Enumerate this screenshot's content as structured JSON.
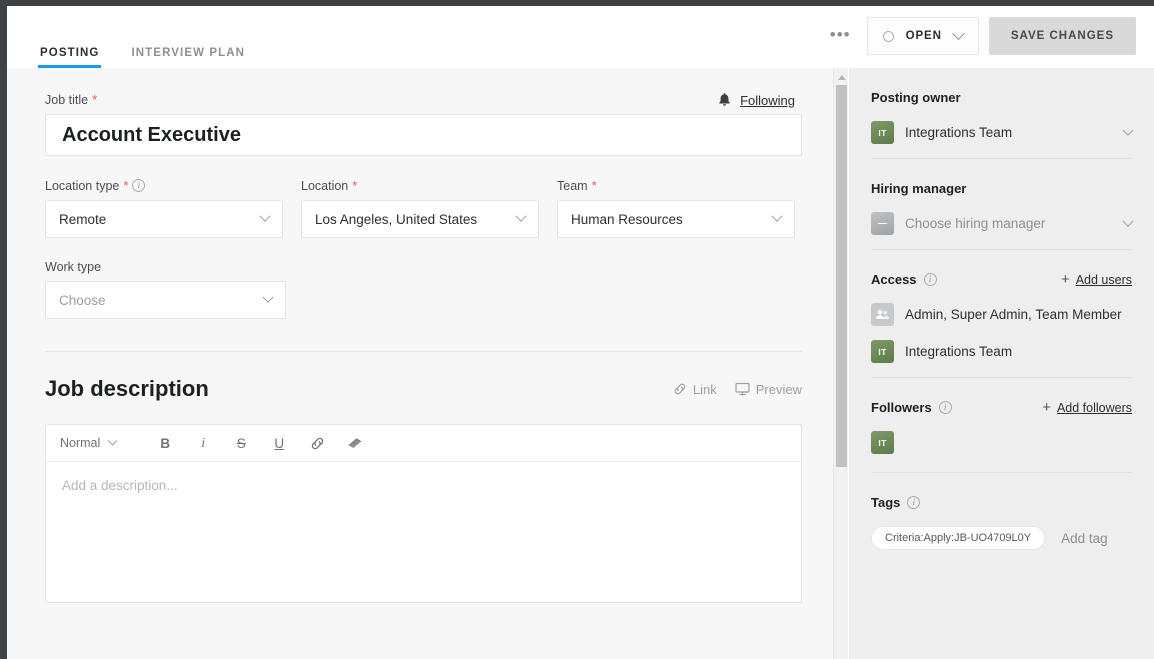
{
  "header": {
    "tabs": [
      {
        "label": "POSTING",
        "active": true
      },
      {
        "label": "INTERVIEW PLAN",
        "active": false
      }
    ],
    "more_menu": "•••",
    "status": {
      "label": "OPEN",
      "icon": "circle-outline-icon"
    },
    "save_label": "SAVE CHANGES"
  },
  "form": {
    "job_title": {
      "label": "Job title",
      "required": "*",
      "value": "Account Executive"
    },
    "following": {
      "label": "Following",
      "icon": "bell-icon"
    },
    "location_type": {
      "label": "Location type",
      "required": "*",
      "value": "Remote"
    },
    "location": {
      "label": "Location",
      "required": "*",
      "value": "Los Angeles, United States"
    },
    "team": {
      "label": "Team",
      "required": "*",
      "value": "Human Resources"
    },
    "work_type": {
      "label": "Work type",
      "value": "Choose"
    }
  },
  "description": {
    "title": "Job description",
    "link_action": "Link",
    "preview_action": "Preview",
    "toolbar": {
      "style": "Normal",
      "bold": "B",
      "italic": "i",
      "strike": "S",
      "underline": "U",
      "link": "link-icon",
      "clear": "eraser-icon"
    },
    "placeholder": "Add a description..."
  },
  "sidebar": {
    "posting_owner": {
      "title": "Posting owner",
      "value": "Integrations Team",
      "avatar_initials": "IT"
    },
    "hiring_manager": {
      "title": "Hiring manager",
      "value": "Choose hiring manager",
      "avatar_initials": ""
    },
    "access": {
      "title": "Access",
      "add_label": "Add users",
      "items": [
        {
          "label": "Admin, Super Admin, Team Member",
          "avatar_type": "group",
          "avatar_initials": ""
        },
        {
          "label": "Integrations Team",
          "avatar_type": "team",
          "avatar_initials": "IT"
        }
      ]
    },
    "followers": {
      "title": "Followers",
      "add_label": "Add followers",
      "avatars": [
        {
          "initials": "IT"
        }
      ]
    },
    "tags": {
      "title": "Tags",
      "items": [
        "Criteria:Apply:JB-UO4709L0Y"
      ],
      "add_label": "Add tag"
    }
  },
  "colors": {
    "accent": "#1a9bf0",
    "required": "#e05b4b",
    "team_avatar": "#6b8e5a",
    "chrome": "#3e4245"
  }
}
